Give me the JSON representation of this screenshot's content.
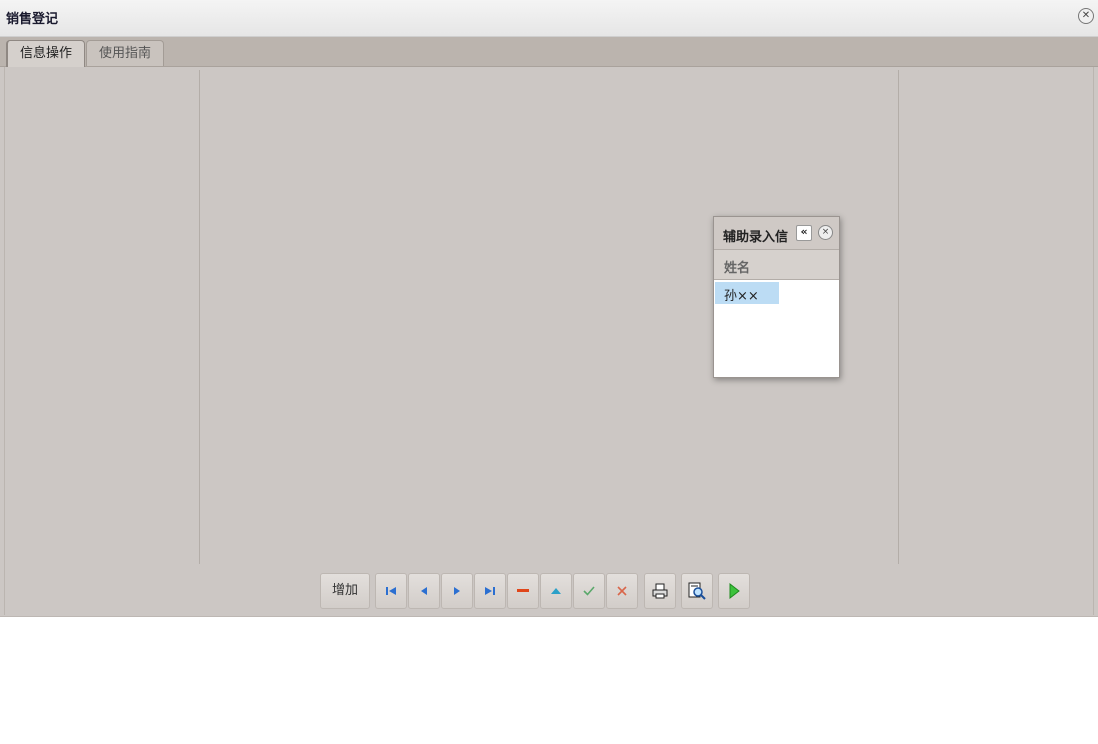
{
  "window": {
    "title": "销售登记"
  },
  "tabs": [
    {
      "label": "信息操作",
      "active": true
    },
    {
      "label": "使用指南",
      "active": false
    }
  ],
  "popup": {
    "title": "辅助录入信",
    "collapse_glyph": "«",
    "close_glyph": "×",
    "column_header": "姓名",
    "rows": [
      "孙××"
    ]
  },
  "toolbar": {
    "add_label": "增加",
    "icons": [
      "first-record-icon",
      "previous-record-icon",
      "next-record-icon",
      "last-record-icon",
      "delete-icon",
      "move-up-icon",
      "confirm-icon",
      "cancel-icon",
      "print-icon",
      "print-preview-icon",
      "run-icon"
    ]
  },
  "colors": {
    "accent_blue": "#2b6fd1",
    "delete_red": "#e0461a",
    "confirm_green": "#5aa86b",
    "cancel_red": "#d9664a",
    "run_green": "#3cc23c",
    "selected_row": "#bcdcf4"
  }
}
